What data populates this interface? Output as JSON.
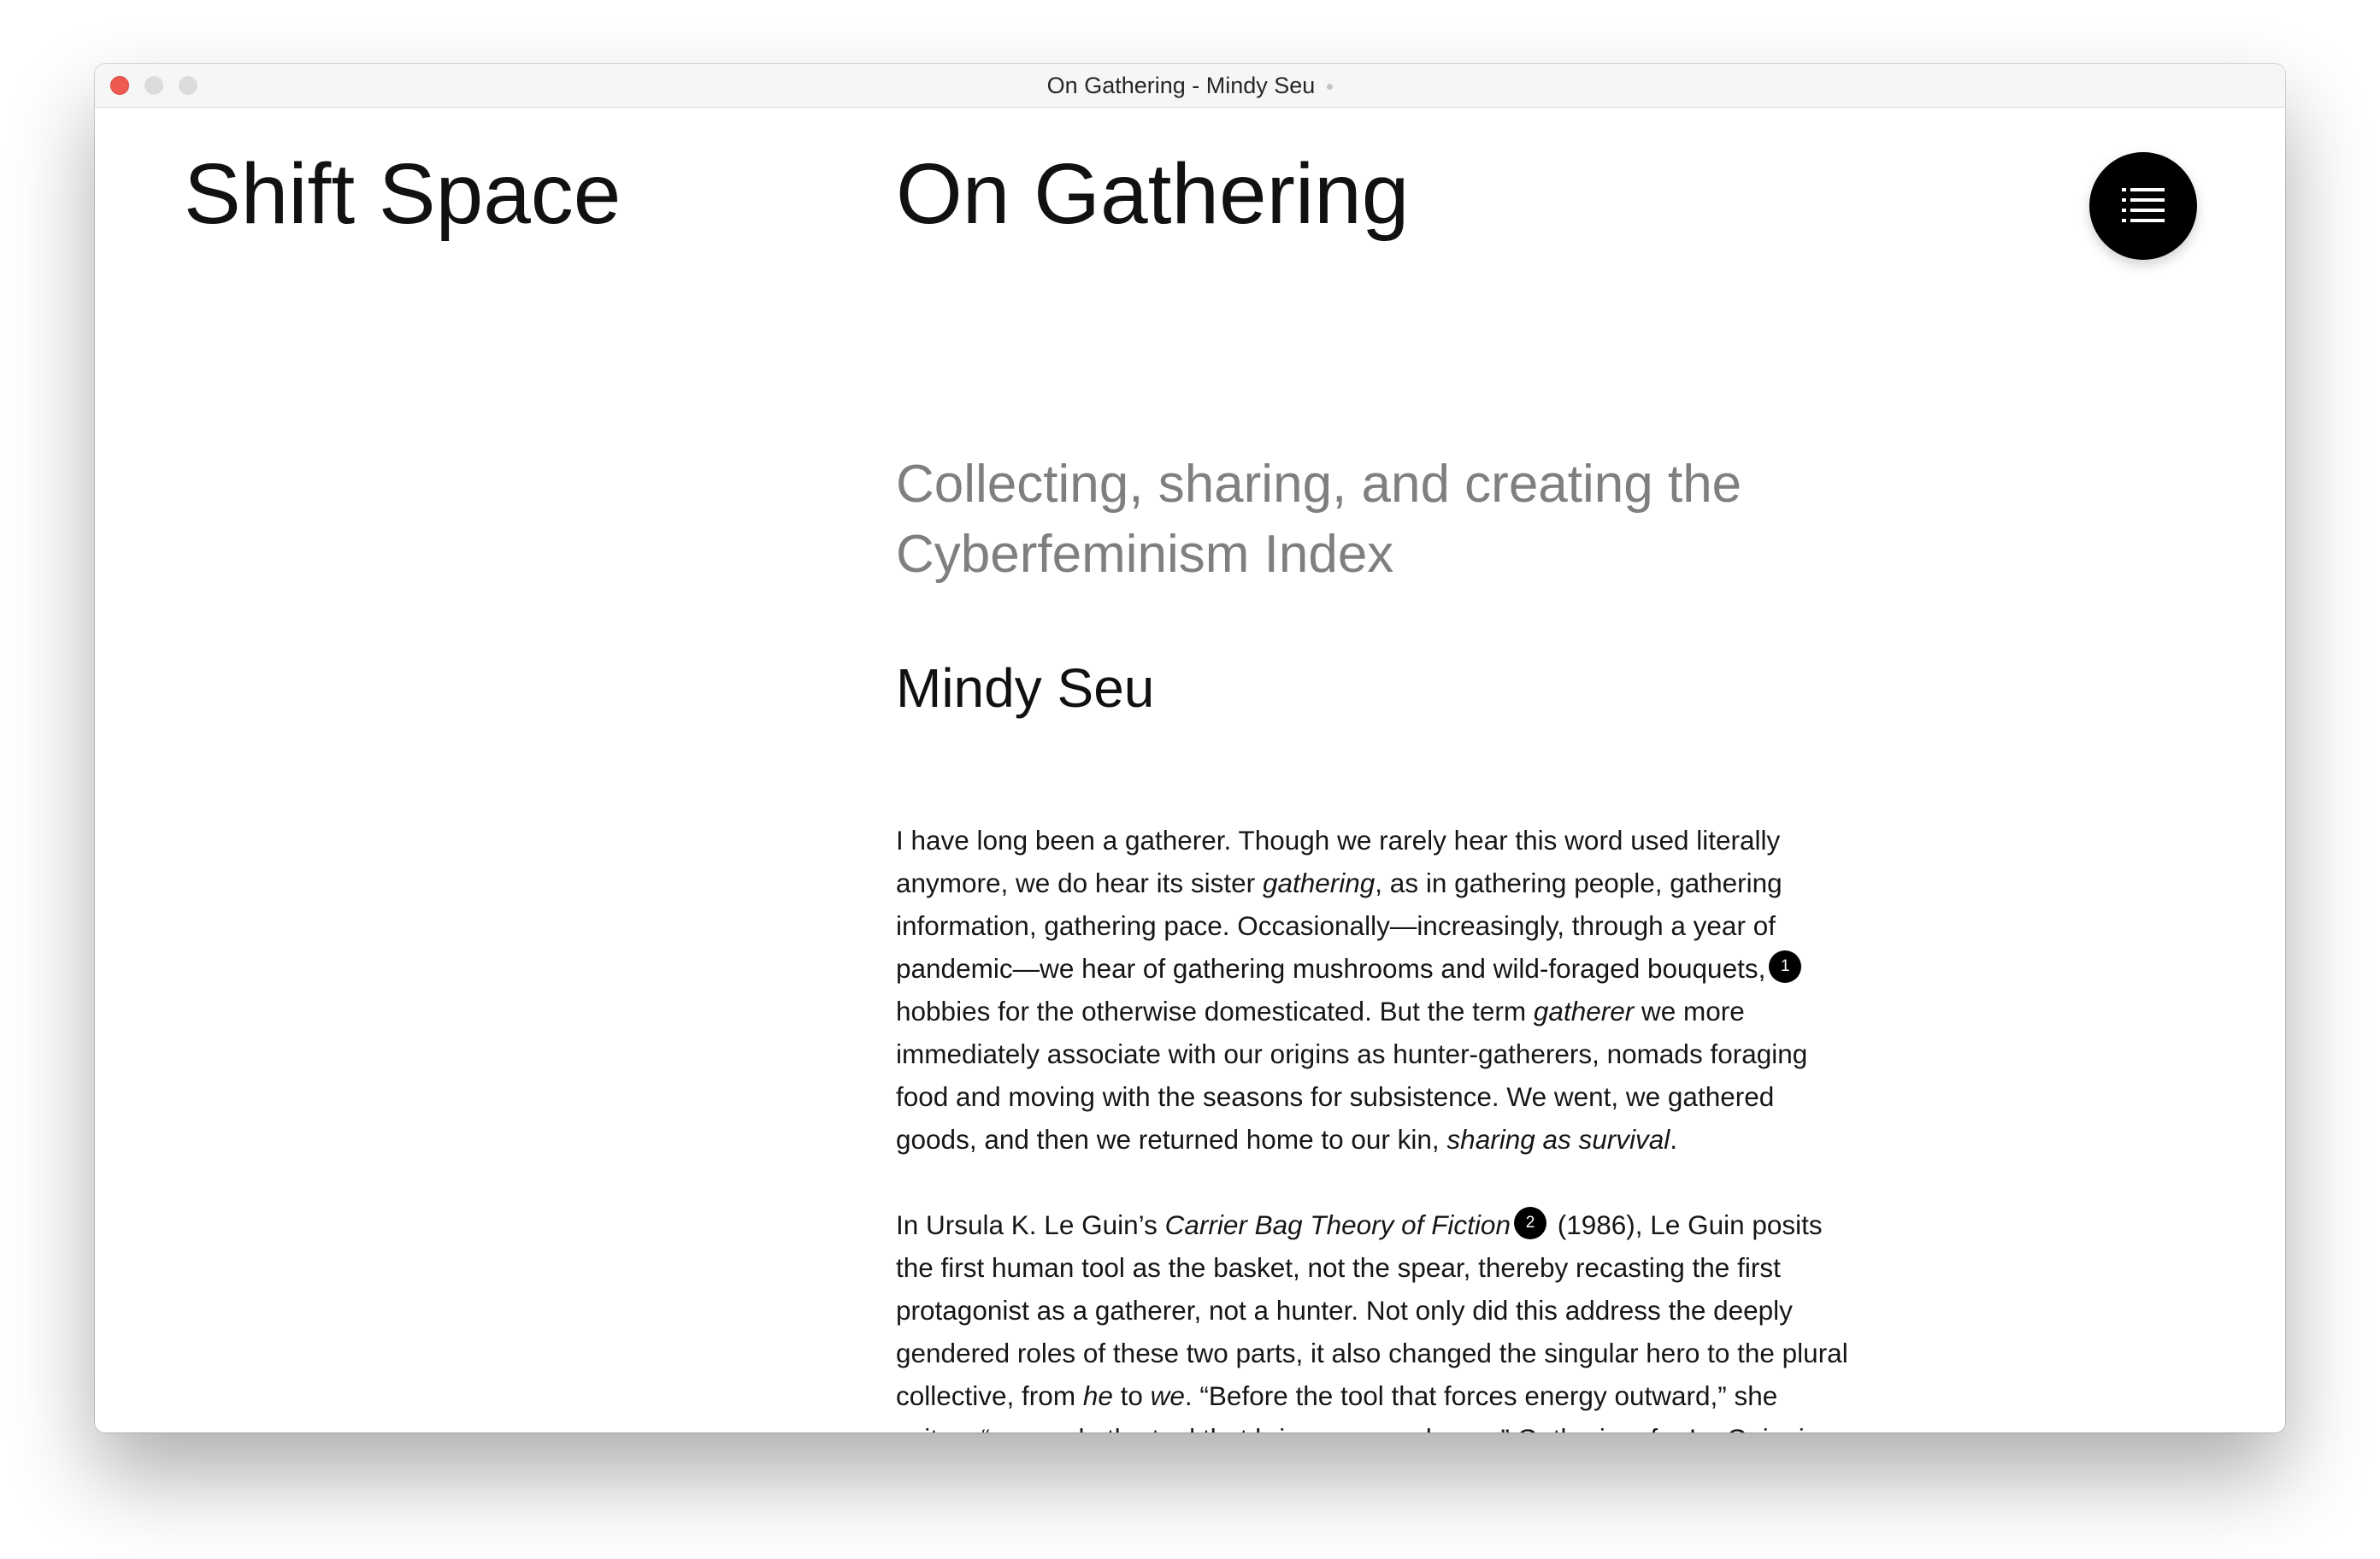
{
  "window": {
    "title": "On Gathering - Mindy Seu"
  },
  "site": {
    "title": "Shift Space"
  },
  "article": {
    "title": "On Gathering",
    "subtitle": "Collecting, sharing, and creating the Cyberfeminism Index",
    "author": "Mindy Seu",
    "menu_icon": "list-icon",
    "p1": {
      "a": "I have long been a gatherer. Though we rarely hear this word used literally anymore, we do hear its sister ",
      "em1": "gathering",
      "b": ", as in gathering people, gathering information, gathering pace. Occasionally—increasingly, through a year of pandemic—we hear of gathering mushrooms and wild-foraged bouquets,",
      "fn": "1",
      "c": " hobbies for the otherwise domesticated. But the term ",
      "em2": "gatherer",
      "d": " we more immediately associate with our origins as hunter-gatherers, nomads foraging food and moving with the seasons for subsistence. We went, we gathered goods, and then we returned home to our kin, ",
      "em3": "sharing as survival",
      "e": "."
    },
    "p2": {
      "a": "In Ursula K. Le Guin’s ",
      "em1": "Carrier Bag Theory of Fiction",
      "fn": "2",
      "b": " (1986), Le Guin posits the first human tool as the basket, not the spear, thereby recasting the first protagonist as a gatherer, not a hunter. Not only did this address the deeply gendered roles of these two parts, it also changed the singular hero to the plural collective, from ",
      "em2": "he",
      "c": " to ",
      "em3": "we",
      "d": ". “Before the tool that forces energy outward,” she writes, “we made the tool that brings energy home.” Gathering, for Le Guin, is a way of being together."
    }
  },
  "colors": {
    "close_button": "#ee5a52",
    "subtitle": "#7f7f7f",
    "menu_button_bg": "#000000"
  }
}
